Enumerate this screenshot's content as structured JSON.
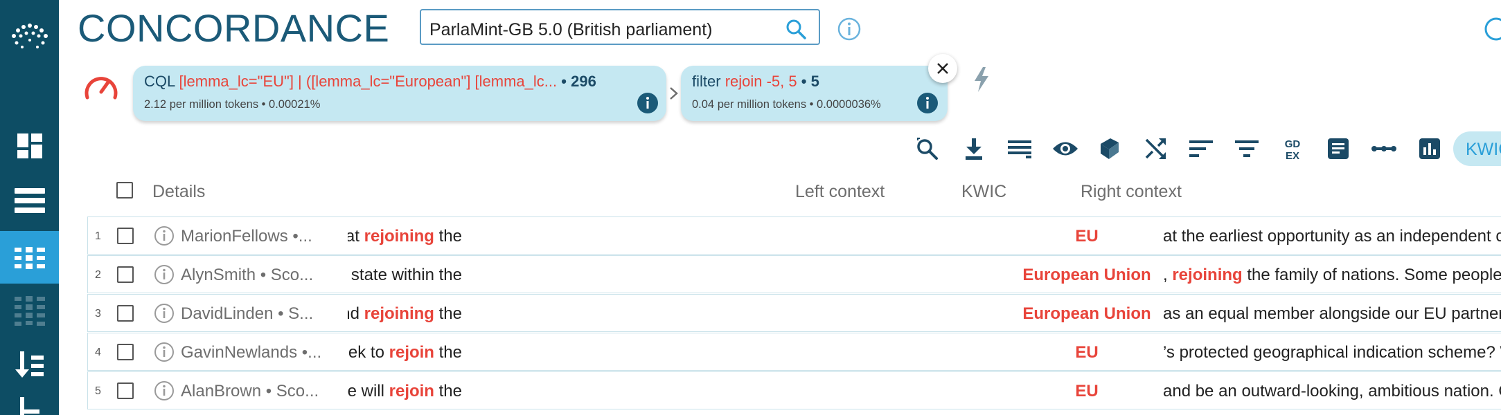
{
  "header": {
    "title": "CONCORDANCE",
    "corpus": "ParlaMint-GB 5.0 (British parliament)"
  },
  "query_chain": [
    {
      "type_label": "CQL",
      "query": "[lemma_lc=\"EU\"] | ([lemma_lc=\"European\"] [lemma_lc...",
      "count": "296",
      "per_million": "2.12 per million tokens",
      "percent": "0.00021%"
    },
    {
      "type_label": "filter",
      "query": "rejoin -5, 5",
      "count": "5",
      "per_million": "0.04 per million tokens",
      "percent": "0.0000036%"
    }
  ],
  "toolbar": {
    "kwic_label": "KWIC",
    "icons": [
      "zoom-search-icon",
      "download-icon",
      "list-lines-icon",
      "eye-icon",
      "book-icon",
      "shuffle-icon",
      "sort-icon",
      "filter-icon",
      "gdex-icon",
      "document-icon",
      "dots-line-icon",
      "bar-chart-icon"
    ]
  },
  "table": {
    "columns": {
      "details": "Details",
      "left": "Left context",
      "kwic": "KWIC",
      "right": "Right context"
    },
    "rows": [
      {
        "num": "1",
        "details": "MarionFellows •...",
        "left_pre": "nt integrate further in future years. It is the SNP’s view that ",
        "left_hl": "rejoining",
        "left_post": " the",
        "kwic": "EU",
        "right_hl": "",
        "right": "at the earliest opportunity as an independent country"
      },
      {
        "num": "2",
        "details": "AlynSmith • Sco...",
        "left_pre": "believe that Scotland’s best future is as an independent state within the",
        "left_hl": "",
        "left_post": "",
        "kwic": "European Union",
        "right_hl": "rejoining",
        "right": ", rejoining the family of nations. Some people in Stirl"
      },
      {
        "num": "3",
        "details": "DavidLinden • S...",
        "left_pre": "to be a part of it. Instead, we seek an independent Scotland ",
        "left_hl": "rejoining",
        "left_post": " the",
        "kwic": "European Union",
        "right_hl": "",
        "right": "as an equal member alongside our EU partners. We"
      },
      {
        "num": "4",
        "details": "GavinNewlands •...",
        "left_pre": "nd, and will the Government do a welcome U-turn and seek to ",
        "left_hl": "rejoin",
        "left_post": " the",
        "kwic": "EU",
        "right_hl": "",
        "right": "’s protected geographical indication scheme? We will"
      },
      {
        "num": "5",
        "details": "AlanBrown • Sco...",
        "left_pre": "ds independence is coming, it is coming soon, and then we will ",
        "left_hl": "rejoin",
        "left_post": " the",
        "kwic": "EU",
        "right_hl": "",
        "right": "and be an outward-looking, ambitious nation. Order. A"
      }
    ]
  },
  "colors": {
    "sidebar": "#0d4d64",
    "sidebar_active": "#2a9fd8",
    "accent_red": "#e8443a",
    "title_blue": "#1b5a78",
    "pill_bg": "#c5e8f2"
  }
}
